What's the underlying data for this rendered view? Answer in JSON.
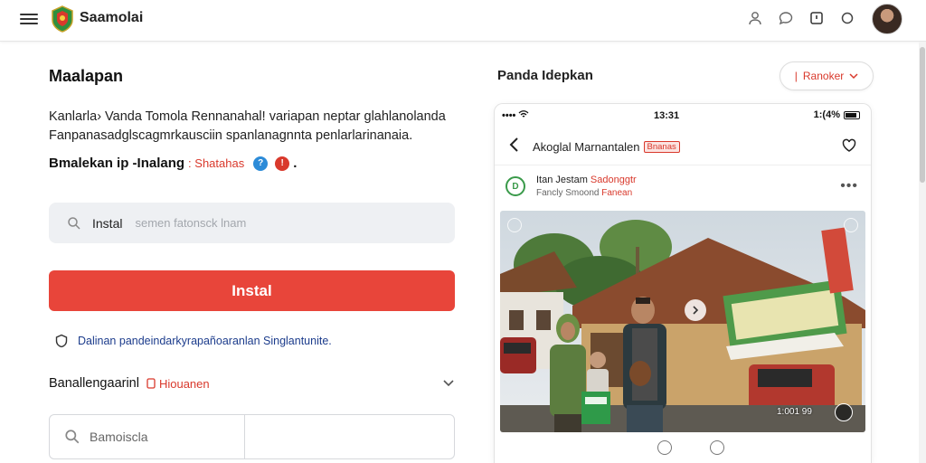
{
  "header": {
    "brand": "Saamolai",
    "icons": [
      "user-icon",
      "chat-icon",
      "bookmark-icon",
      "notification-icon"
    ]
  },
  "left": {
    "title": "Maalapan",
    "description": "Kanlarla› Vanda Tomola Rennanahal! variapan neptar glahlanolanda Fanpanasadglscagmrkausciin spanlanagnnta penlarlarinanaia.",
    "subheading": "Bmalekan ip -Inalang",
    "subheading_tag": ": Shatahas",
    "search": {
      "label": "Instal",
      "placeholder": "semen fatonsck lnam"
    },
    "install_button": "Instal",
    "info_text": "Dalinan pandeindarkyrapañoaranlan Singlantunite.",
    "section_label": "Banallengaarinl",
    "section_tag": "Hiouanen",
    "bottom_input_placeholder": "Bamoiscla"
  },
  "right": {
    "title": "Panda Idepkan",
    "filter_button": "Ranoker",
    "phone": {
      "signal": "•••• ",
      "time": "13:31",
      "battery": "1:(4%",
      "app_title": "Akoglal Marnantalen",
      "app_title_tag": "Bnanas",
      "post_name": "Itan Jestam",
      "post_name_tag": "Sadonggtr",
      "post_sub": "Fancly Smoond",
      "post_sub_tag": "Fanean",
      "photo_count": "1:001 99"
    }
  },
  "colors": {
    "accent_red": "#e8453a",
    "link_blue": "#1c3c8c",
    "tag_red": "#d9392c",
    "brand_green": "#3a9a4a"
  }
}
